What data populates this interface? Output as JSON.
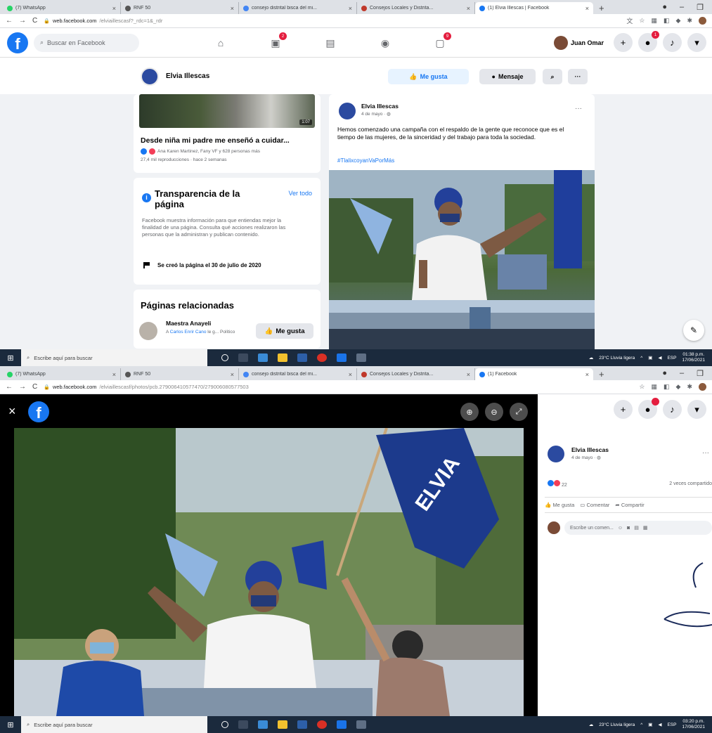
{
  "colors": {
    "facebook_blue": "#1877f2",
    "badge_red": "#e41e3f",
    "taskbar": "#1b2a3d"
  },
  "screen1": {
    "tabs": [
      {
        "title": "(7) WhatsApp",
        "fav": "#25d366"
      },
      {
        "title": "RNF 50",
        "fav": "#555"
      },
      {
        "title": "consejo distrital bisca del mi...",
        "fav": "#4285f4"
      },
      {
        "title": "Consejos Locales y Distrita...",
        "fav": "#c0392b"
      },
      {
        "title": "(1) Elvia Illescas | Facebook",
        "fav": "#1877f2"
      }
    ],
    "url": {
      "host": "web.facebook.com",
      "path": "/elviaillescasf?_rdc=1&_rdr"
    },
    "search_placeholder": "Buscar en Facebook",
    "badges": {
      "watch": "2",
      "groups": "9",
      "notif": "1"
    },
    "user_name": "Juan Omar",
    "page_name": "Elvia Illescas",
    "buttons": {
      "like": "Me gusta",
      "message": "Mensaje",
      "more": "···"
    },
    "video": {
      "title": "Desde niña mi padre me enseñó a cuidar...",
      "reactions": "Ana Karen Martinez, Fany VF y 628 personas más",
      "views": "27,4 mil reproducciones · hace 2 semanas",
      "duration": "1:07"
    },
    "transparency": {
      "title": "Transparencia de la página",
      "see_all": "Ver todo",
      "desc": "Facebook muestra información para que entiendas mejor la finalidad de una página. Consulta qué acciones realizaron las personas que la administran y publican contenido.",
      "created": "Se creó la página el 30 de julio de 2020"
    },
    "related": {
      "title": "Páginas relacionadas",
      "name": "Maestra Anayeli",
      "sub_prefix": "A",
      "sub_name": "Carlos Enrir Cano",
      "sub_rest": "le g... Político",
      "like": "Me gusta"
    },
    "post": {
      "author": "Elvia Illescas",
      "date": "4 de mayo · ",
      "text": "Hemos comenzado una campaña con el respaldo de la gente que reconoce que es el tiempo de las mujeres, de la sinceridad y del trabajo para toda la sociedad.",
      "hashtag": "#TlalixcoyanVaPorMás"
    },
    "taskbar": {
      "search": "Escribe aquí para buscar",
      "weather": "23°C Lluvia ligera",
      "lang": "ESP",
      "time": "01:38 p.m.",
      "date": "17/06/2021"
    }
  },
  "screen2": {
    "tabs": [
      {
        "title": "(7) WhatsApp",
        "fav": "#25d366"
      },
      {
        "title": "RNF 50",
        "fav": "#555"
      },
      {
        "title": "consejo distrital bisca del mi...",
        "fav": "#4285f4"
      },
      {
        "title": "Consejos Locales y Distrita...",
        "fav": "#c0392b"
      },
      {
        "title": "(1) Facebook",
        "fav": "#1877f2"
      }
    ],
    "url": {
      "host": "web.facebook.com",
      "path": "/elviaillescasf/photos/pcb.279006410577470/279006080577503"
    },
    "flag_text": "ELVIA",
    "author": "Elvia Illescas",
    "date": "4 de mayo · ",
    "reaction_count": "22",
    "shares": "2 veces compartido",
    "actions": {
      "like": "Me gusta",
      "comment": "Comentar",
      "share": "Compartir"
    },
    "comment_placeholder": "Escribe un comen...",
    "taskbar": {
      "search": "Escribe aquí para buscar",
      "weather": "23°C Lluvia ligera",
      "lang": "ESP",
      "time": "03:20 p.m.",
      "date": "17/06/2021"
    }
  }
}
